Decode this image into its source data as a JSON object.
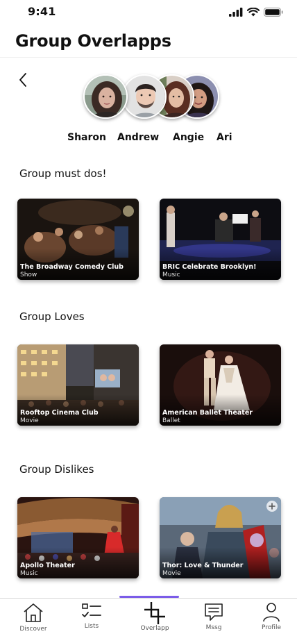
{
  "status": {
    "time": "9:41"
  },
  "header": {
    "title": "Group Overlapps"
  },
  "group": {
    "members": [
      {
        "name": "Sharon"
      },
      {
        "name": "Andrew"
      },
      {
        "name": "Angie"
      },
      {
        "name": "Ari"
      }
    ]
  },
  "sections": [
    {
      "title": "Group must dos!",
      "cards": [
        {
          "title": "The Broadway Comedy Club",
          "category": "Show"
        },
        {
          "title": "BRIC Celebrate Brooklyn!",
          "category": "Music"
        }
      ]
    },
    {
      "title": "Group Loves",
      "cards": [
        {
          "title": "Rooftop Cinema Club",
          "category": "Movie"
        },
        {
          "title": "American Ballet Theater",
          "category": "Ballet"
        }
      ]
    },
    {
      "title": "Group Dislikes",
      "cards": [
        {
          "title": "Apollo Theater",
          "category": "Music"
        },
        {
          "title": "Thor: Love & Thunder",
          "category": "Movie"
        }
      ]
    }
  ],
  "nav": {
    "items": [
      {
        "label": "Discover",
        "icon": "home-icon"
      },
      {
        "label": "Lists",
        "icon": "checklist-icon"
      },
      {
        "label": "Overlapp",
        "icon": "overlapp-icon",
        "active": true
      },
      {
        "label": "Mssg",
        "icon": "message-icon"
      },
      {
        "label": "Profile",
        "icon": "person-icon"
      }
    ],
    "accent": "#7b5ce8"
  }
}
